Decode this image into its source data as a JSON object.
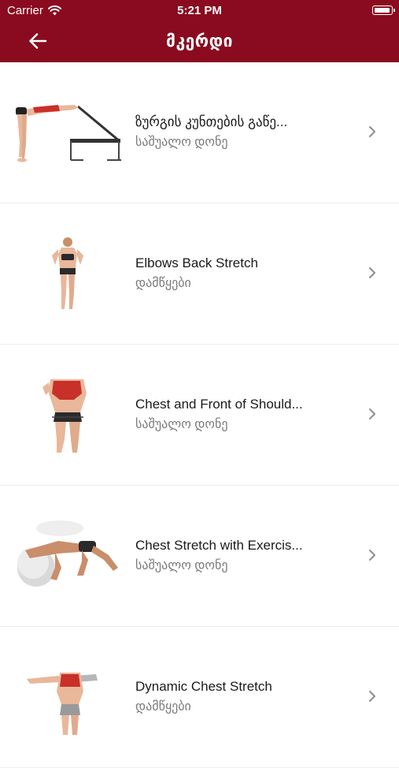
{
  "status_bar": {
    "carrier": "Carrier",
    "time": "5:21 PM",
    "battery_level": 1.0,
    "wifi_icon": "wifi-icon"
  },
  "nav": {
    "back_icon": "arrow-left-icon",
    "title": "მკერდი"
  },
  "colors": {
    "header": "#8a0b1f",
    "title_text": "#1a1a1a",
    "subtitle_text": "#7a7a7a",
    "chevron": "#8e8e8e",
    "muscle_highlight": "#c8302a",
    "skin": "#e9b79a"
  },
  "exercises": [
    {
      "title": "ზურგის კუნთების გაწე...",
      "subtitle": "საშუალო დონე",
      "illustration": "bench-stretch-illustration"
    },
    {
      "title": "Elbows Back Stretch",
      "subtitle": "დამწყები",
      "illustration": "standing-woman-illustration"
    },
    {
      "title": "Chest and Front of Should...",
      "subtitle": "საშუალო დონე",
      "illustration": "band-stretch-illustration"
    },
    {
      "title": "Chest Stretch with Exercis...",
      "subtitle": "საშუალო დონე",
      "illustration": "ball-stretch-illustration"
    },
    {
      "title": "Dynamic Chest Stretch",
      "subtitle": "დამწყები",
      "illustration": "arms-open-illustration"
    }
  ]
}
